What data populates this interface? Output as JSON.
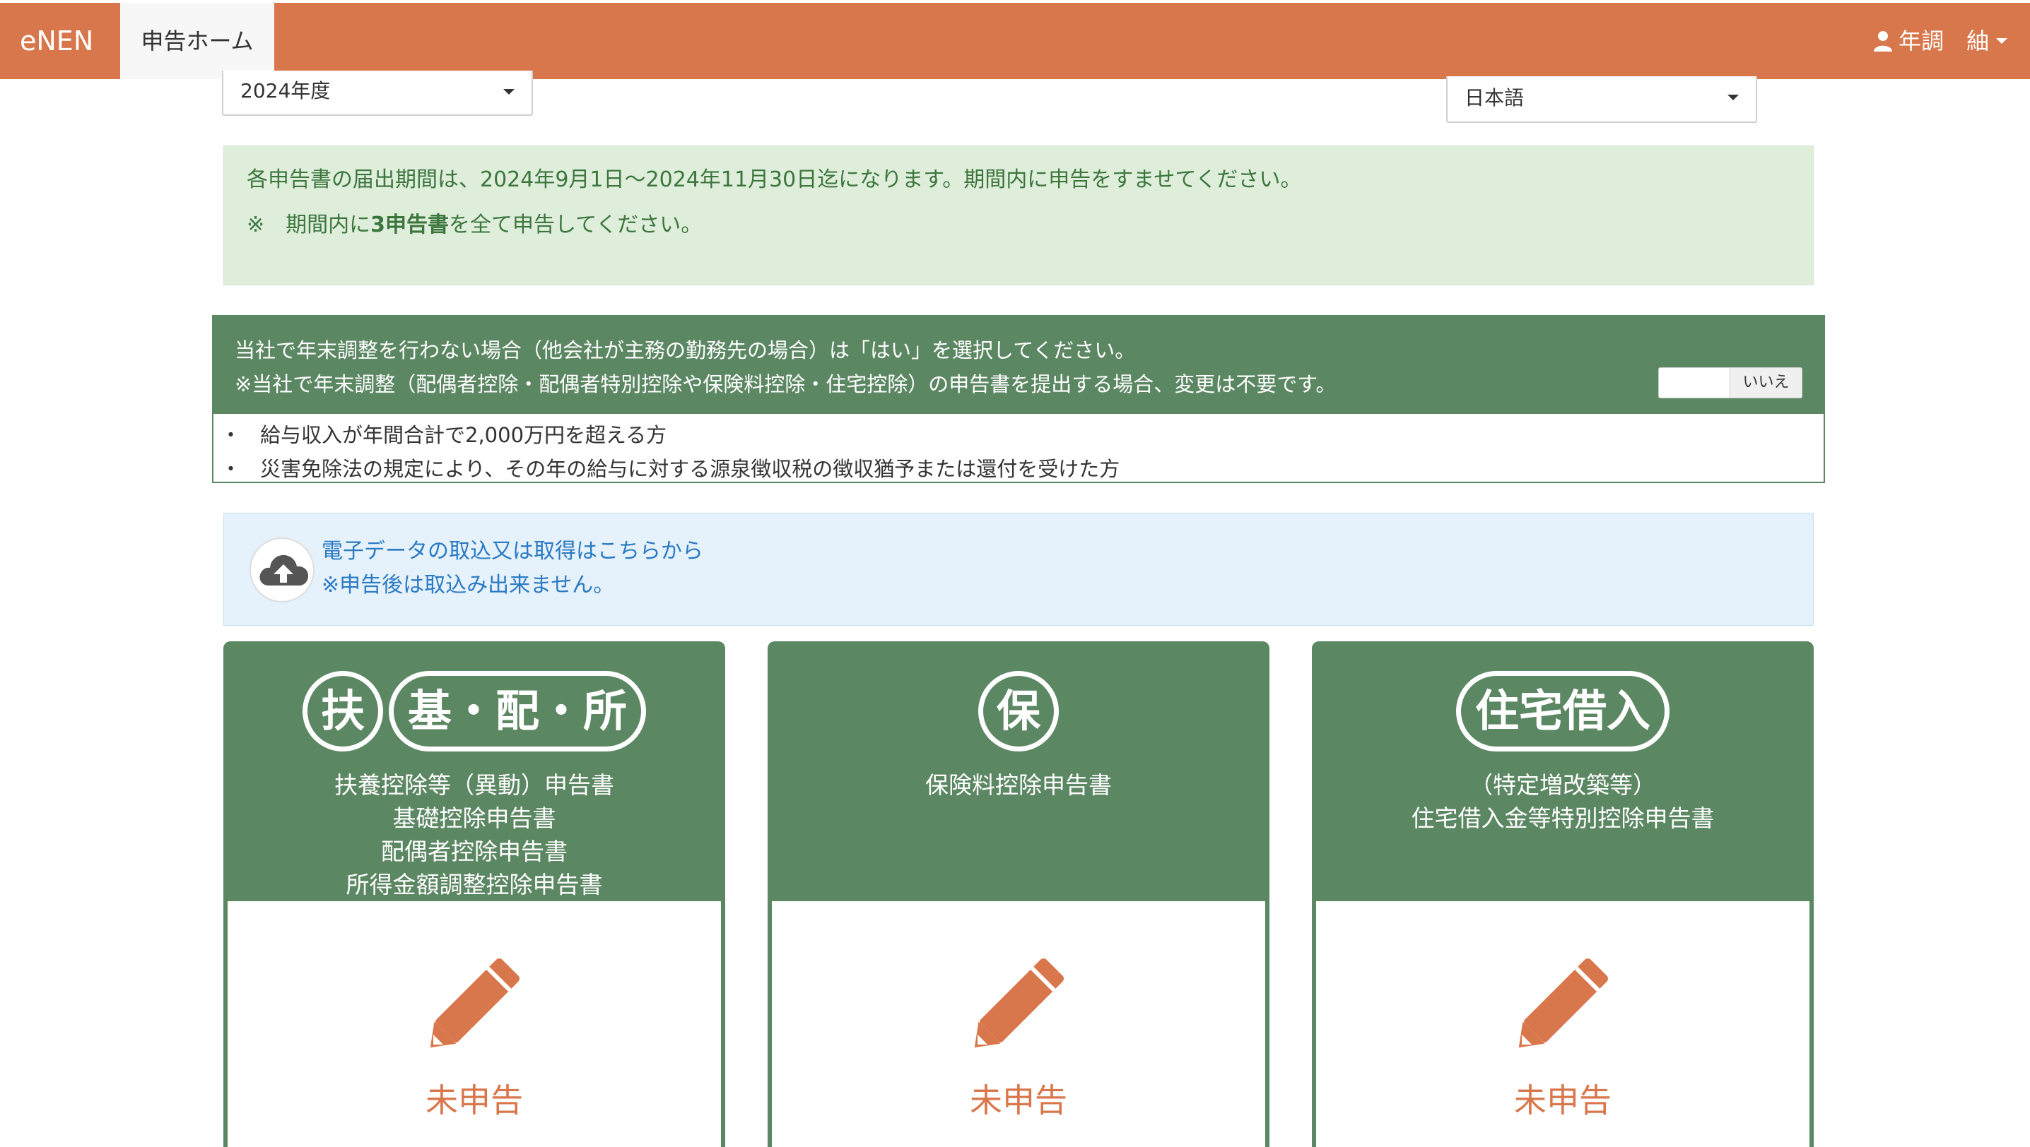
{
  "nav": {
    "brand": "eNEN",
    "home_tab": "申告ホーム",
    "user_label": "年調　紬"
  },
  "year_select": {
    "selected": "2024年度"
  },
  "lang_select": {
    "selected": "日本語"
  },
  "notice": {
    "line1": "各申告書の届出期間は、2024年9月1日〜2024年11月30日迄になります。期間内に申告をすませてください。",
    "line2_prefix": "※　期間内に",
    "line2_bold": "3申告書",
    "line2_suffix": "を全て申告してください。"
  },
  "question_panel": {
    "line1": "当社で年末調整を行わない場合（他会社が主務の勤務先の場合）は「はい」を選択してください。",
    "line2": "※当社で年末調整（配偶者控除・配偶者特別控除や保険料控除・住宅控除）の申告書を提出する場合、変更は不要です。",
    "toggle_value": "いいえ",
    "items": [
      {
        "bullet": "・",
        "text": "給与収入が年間合計で2,000万円を超える方"
      },
      {
        "bullet": "・",
        "text": "災害免除法の規定により、その年の給与に対する源泉徴収税の徴収猶予または還付を受けた方"
      }
    ]
  },
  "upload": {
    "link_text": "電子データの取込又は取得はこちらから",
    "note": "※申告後は取込み出来ません。"
  },
  "cards": [
    {
      "badges": [
        "扶",
        "基・配・所"
      ],
      "titles": [
        "扶養控除等（異動）申告書",
        "基礎控除申告書",
        "配偶者控除申告書",
        "所得金額調整控除申告書"
      ],
      "status": "未申告"
    },
    {
      "badges": [
        "保"
      ],
      "titles": [
        "保険料控除申告書"
      ],
      "status": "未申告"
    },
    {
      "badges": [
        "住宅借入"
      ],
      "titles": [
        "（特定増改築等）",
        "住宅借入金等特別控除申告書"
      ],
      "status": "未申告"
    }
  ],
  "colors": {
    "nav": "#d9774c",
    "green": "#5c8763",
    "notice_bg": "#dfeedb",
    "upload_bg": "#e5f1fb"
  },
  "icons": {
    "user": "user-icon",
    "caret": "caret-down-icon",
    "upload": "cloud-upload-icon",
    "pencil": "pencil-icon"
  }
}
